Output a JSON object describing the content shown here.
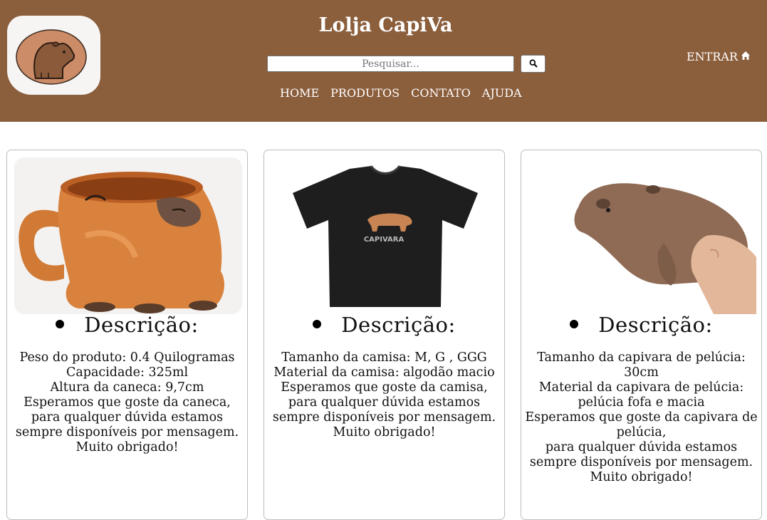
{
  "header": {
    "title": "Lolja CapiVa",
    "logo_icon": "capybara-logo",
    "search": {
      "placeholder": "Pesquisar...",
      "icon": "search-icon"
    },
    "nav": [
      "HOME",
      "PRODUTOS",
      "CONTATO",
      "AJUDA"
    ],
    "login": {
      "label": "ENTRAR",
      "icon": "home-icon"
    }
  },
  "products": [
    {
      "image": "capybara-mug-image",
      "heading": "Descrição:",
      "lines": [
        "Peso do produto: 0.4 Quilogramas",
        "Capacidade: 325ml",
        "Altura da caneca: 9,7cm",
        "Esperamos que goste da caneca,",
        "para qualquer dúvida estamos sempre disponíveis por mensagem. Muito obrigado!"
      ]
    },
    {
      "image": "capybara-tshirt-image",
      "heading": "Descrição:",
      "shirt_print": "CAPIVARA",
      "lines": [
        "Tamanho da camisa: M, G , GGG",
        "Material da camisa: algodão macio",
        "Esperamos que goste da camisa,",
        "para qualquer dúvida estamos sempre disponíveis por mensagem. Muito obrigado!"
      ]
    },
    {
      "image": "capybara-plush-image",
      "heading": "Descrição:",
      "lines": [
        "Tamanho da capivara de pelúcia: 30cm",
        "Material da capivara de pelúcia: pelúcia fofa e macia",
        "Esperamos que goste da capivara de pelúcia,",
        "para qualquer dúvida estamos sempre disponíveis por mensagem. Muito obrigado!"
      ]
    }
  ],
  "colors": {
    "header_bg": "#8b5e3c",
    "card_border": "#bdbdbd",
    "text": "#111111"
  }
}
